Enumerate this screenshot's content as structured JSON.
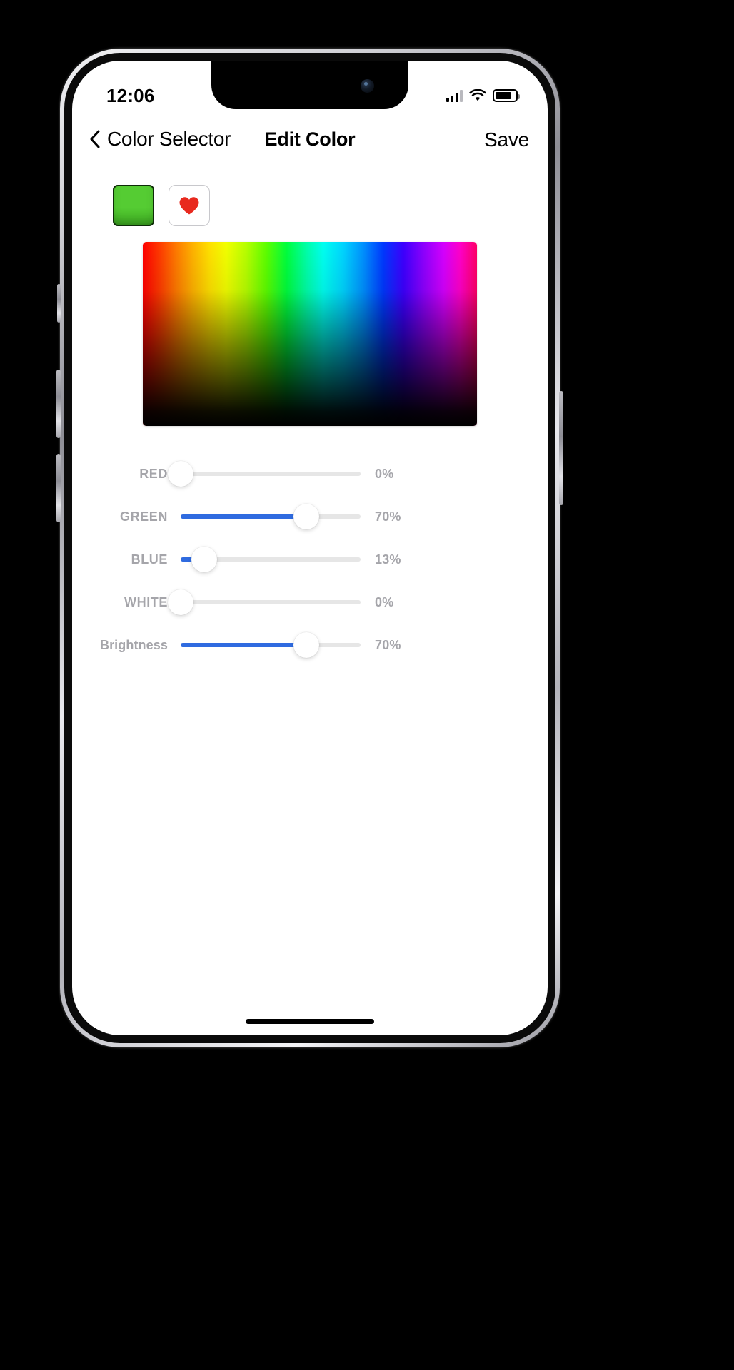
{
  "status_bar": {
    "time": "12:06",
    "cellular_icon": "cellular-bars-icon",
    "wifi_icon": "wifi-icon",
    "battery_icon": "battery-icon"
  },
  "nav_bar": {
    "back_icon": "chevron-left-icon",
    "back_label": "Color Selector",
    "title": "Edit Color",
    "save_label": "Save"
  },
  "swatches": {
    "current_color_hex": "#55cc33",
    "favorite_icon": "heart-icon",
    "favorite_icon_color": "#e8291e"
  },
  "gradient_picker": {
    "name": "hue-brightness-gradient"
  },
  "sliders": [
    {
      "label": "RED",
      "value": 0,
      "value_text": "0%",
      "style": "upper"
    },
    {
      "label": "GREEN",
      "value": 70,
      "value_text": "70%",
      "style": "upper"
    },
    {
      "label": "BLUE",
      "value": 13,
      "value_text": "13%",
      "style": "upper"
    },
    {
      "label": "WHITE",
      "value": 0,
      "value_text": "0%",
      "style": "upper"
    },
    {
      "label": "Brightness",
      "value": 70,
      "value_text": "70%",
      "style": "mixed"
    }
  ],
  "theme": {
    "accent_blue": "#2f6be0",
    "track_gray": "#e6e6e6",
    "label_gray": "#a5a5aa"
  }
}
